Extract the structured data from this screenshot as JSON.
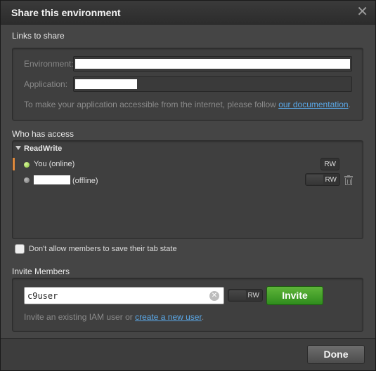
{
  "dialog": {
    "title": "Share this environment",
    "close_icon": "close-icon"
  },
  "links": {
    "section_label": "Links to share",
    "environment_label": "Environment:",
    "application_label": "Application:",
    "help_text": "To make your application accessible from the internet, please follow ",
    "help_link": "our documentation",
    "help_suffix": "."
  },
  "access": {
    "section_label": "Who has access",
    "group_label": "ReadWrite",
    "members": [
      {
        "name": "You (online)",
        "status": "online",
        "permission": "RW",
        "removable": false
      },
      {
        "name": "(offline)",
        "status": "offline",
        "permission": "RW",
        "removable": true
      }
    ]
  },
  "options": {
    "tab_state_label": "Don't allow members to save their tab state",
    "tab_state_checked": false
  },
  "invite": {
    "section_label": "Invite Members",
    "input_value": "c9user",
    "permission_toggle": "RW",
    "invite_button": "Invite",
    "hint_text": "Invite an existing IAM user or ",
    "hint_link": "create a new user",
    "hint_suffix": "."
  },
  "footer": {
    "done_button": "Done"
  },
  "colors": {
    "accent_link": "#5aa7e6",
    "invite_green": "#3fa42a",
    "online": "#8ac63c",
    "active_marker": "#e08a3c"
  }
}
